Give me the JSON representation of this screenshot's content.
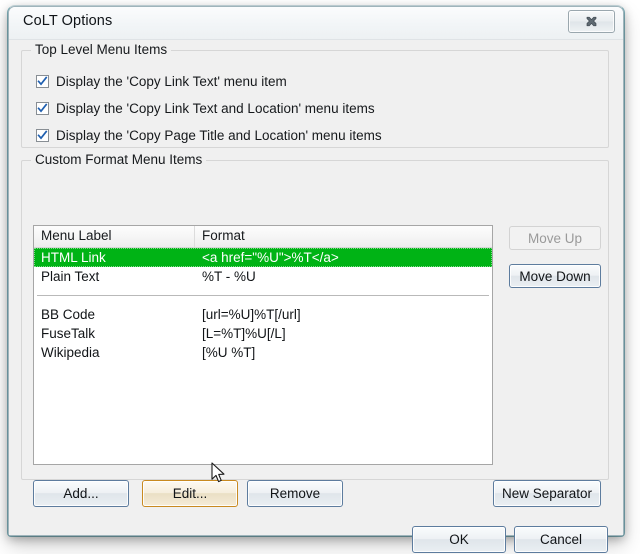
{
  "window": {
    "title": "CoLT Options",
    "close_icon": "close-x-icon"
  },
  "groups": {
    "top_level": {
      "title": "Top Level Menu Items",
      "checkboxes": [
        {
          "label": "Display the 'Copy Link Text' menu item",
          "checked": true
        },
        {
          "label": "Display the 'Copy Link Text and Location' menu items",
          "checked": true
        },
        {
          "label": "Display the 'Copy Page Title and Location' menu items",
          "checked": true
        }
      ]
    },
    "custom_format": {
      "title": "Custom Format Menu Items"
    }
  },
  "listview": {
    "columns": [
      "Menu Label",
      "Format"
    ],
    "rows": [
      {
        "type": "item",
        "label": "HTML Link",
        "format": "<a href=\"%U\">%T</a>",
        "selected": true
      },
      {
        "type": "item",
        "label": "Plain Text",
        "format": "%T - %U",
        "selected": false
      },
      {
        "type": "separator"
      },
      {
        "type": "item",
        "label": "BB Code",
        "format": "[url=%U]%T[/url]",
        "selected": false
      },
      {
        "type": "item",
        "label": "FuseTalk",
        "format": "[L=%T]%U[/L]",
        "selected": false
      },
      {
        "type": "item",
        "label": "Wikipedia",
        "format": "[%U %T]",
        "selected": false
      }
    ],
    "selection_color": "#00b315"
  },
  "buttons": {
    "move_up": {
      "label": "Move Up",
      "enabled": false
    },
    "move_down": {
      "label": "Move Down",
      "enabled": true
    },
    "add": {
      "label": "Add..."
    },
    "edit": {
      "label": "Edit...",
      "state": "hover"
    },
    "remove": {
      "label": "Remove"
    },
    "new_separator": {
      "label": "New Separator"
    },
    "ok": {
      "label": "OK"
    },
    "cancel": {
      "label": "Cancel"
    }
  }
}
